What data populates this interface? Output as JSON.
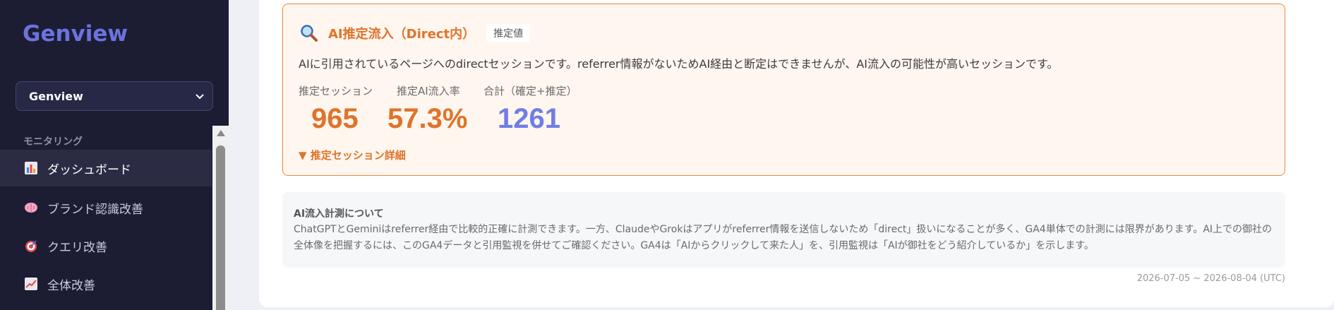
{
  "sidebar": {
    "brand": "Genview",
    "project_select": "Genview",
    "section_label": "モニタリング",
    "items": [
      {
        "label": "ダッシュボード",
        "icon": "bar-chart-icon"
      },
      {
        "label": "ブランド認識改善",
        "icon": "brain-icon"
      },
      {
        "label": "クエリ改善",
        "icon": "target-icon"
      },
      {
        "label": "全体改善",
        "icon": "trend-up-icon"
      }
    ]
  },
  "ai_card": {
    "title": "AI推定流入（Direct内）",
    "badge": "推定値",
    "description": "AIに引用されているページへのdirectセッションです。referrer情報がないためAI経由と断定はできませんが、AI流入の可能性が高いセッションです。",
    "metrics": [
      {
        "label": "推定セッション",
        "value": "965"
      },
      {
        "label": "推定AI流入率",
        "value": "57.3%"
      },
      {
        "label": "合計（確定+推定）",
        "value": "1261"
      }
    ],
    "details_link": "▼ 推定セッション詳細"
  },
  "note": {
    "title": "AI流入計測について",
    "body": "ChatGPTとGeminiはreferrer経由で比較的正確に計測できます。一方、ClaudeやGrokはアプリがreferrer情報を送信しないため「direct」扱いになることが多く、GA4単体での計測には限界があります。AI上での御社の全体像を把握するには、このGA4データと引用監視を併せてご確認ください。GA4は「AIからクリックして来た人」を、引用監視は「AIが御社をどう紹介しているか」を示します。"
  },
  "date_range": "2026-07-05 ~ 2026-08-04 (UTC)",
  "colors": {
    "accent_orange": "#e0732a",
    "accent_blue": "#6f7ee6",
    "sidebar_bg": "#1c1d32"
  }
}
